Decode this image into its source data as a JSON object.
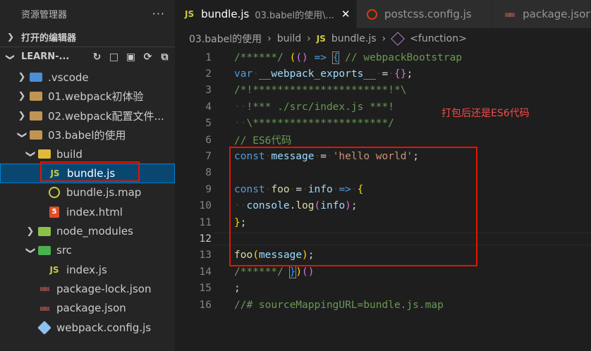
{
  "sidebar": {
    "title": "资源管理器",
    "more": "···",
    "open_editors": "打开的编辑器",
    "project": "LEARN-...",
    "tree": [
      {
        "label": ".vscode",
        "type": "folder",
        "variant": "vscode",
        "depth": 1,
        "expanded": false
      },
      {
        "label": "01.webpack初体验",
        "type": "folder",
        "variant": "plain",
        "depth": 1,
        "expanded": false
      },
      {
        "label": "02.webpack配置文件...",
        "type": "folder",
        "variant": "plain",
        "depth": 1,
        "expanded": false
      },
      {
        "label": "03.babel的使用",
        "type": "folder",
        "variant": "plain",
        "depth": 1,
        "expanded": true
      },
      {
        "label": "build",
        "type": "folder",
        "variant": "build",
        "depth": 2,
        "expanded": true
      },
      {
        "label": "bundle.js",
        "type": "js",
        "depth": 3,
        "selected": true
      },
      {
        "label": "bundle.js.map",
        "type": "map",
        "depth": 3
      },
      {
        "label": "index.html",
        "type": "html",
        "depth": 3
      },
      {
        "label": "node_modules",
        "type": "folder",
        "variant": "node",
        "depth": 2,
        "expanded": false
      },
      {
        "label": "src",
        "type": "folder",
        "variant": "src",
        "depth": 2,
        "expanded": true
      },
      {
        "label": "index.js",
        "type": "js",
        "depth": 3
      },
      {
        "label": "package-lock.json",
        "type": "json",
        "depth": 2
      },
      {
        "label": "package.json",
        "type": "json",
        "depth": 2
      },
      {
        "label": "webpack.config.js",
        "type": "webpack",
        "depth": 2
      }
    ]
  },
  "tabs": [
    {
      "icon": "JS",
      "label": "bundle.js",
      "desc": "03.babel的使用\\...",
      "active": true,
      "close": "✕"
    },
    {
      "icon": "postcss",
      "label": "postcss.config.js",
      "active": false
    },
    {
      "icon": "json",
      "label": "package.json",
      "active": false
    }
  ],
  "breadcrumb": {
    "parts": [
      "03.babel的使用",
      "build"
    ],
    "file_icon": "JS",
    "file": "bundle.js",
    "symbol": "<function>"
  },
  "code": {
    "current_line": 12,
    "lines": [
      {
        "n": "1"
      },
      {
        "n": "2"
      },
      {
        "n": "3"
      },
      {
        "n": "4"
      },
      {
        "n": "5"
      },
      {
        "n": "6"
      },
      {
        "n": "7"
      },
      {
        "n": "8"
      },
      {
        "n": "9"
      },
      {
        "n": "10"
      },
      {
        "n": "11"
      },
      {
        "n": "12"
      },
      {
        "n": "13"
      },
      {
        "n": "14"
      },
      {
        "n": "15"
      },
      {
        "n": "16"
      }
    ]
  },
  "annotation": "打包后还是ES6代码",
  "icons": {
    "js": "JS",
    "html": "5",
    "json": "{}",
    "chev_right": "›",
    "chev_down": "⌄"
  }
}
